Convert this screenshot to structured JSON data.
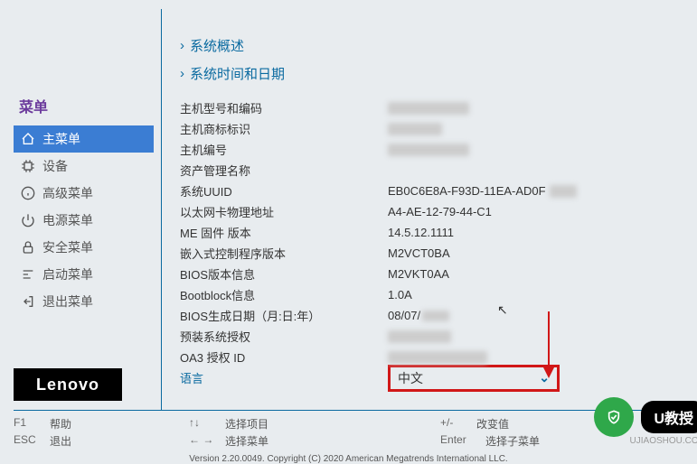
{
  "sidebar": {
    "title": "菜单",
    "items": [
      {
        "label": "主菜单"
      },
      {
        "label": "设备"
      },
      {
        "label": "高级菜单"
      },
      {
        "label": "电源菜单"
      },
      {
        "label": "安全菜单"
      },
      {
        "label": "启动菜单"
      },
      {
        "label": "退出菜单"
      }
    ],
    "logo": "Lenovo"
  },
  "links": {
    "overview": "系统概述",
    "datetime": "系统时间和日期"
  },
  "info": {
    "rows": [
      {
        "label": "主机型号和编码",
        "value": ""
      },
      {
        "label": "主机商标标识",
        "value": ""
      },
      {
        "label": "主机编号",
        "value": ""
      },
      {
        "label": "资产管理名称",
        "value": ""
      },
      {
        "label": "系统UUID",
        "value": "EB0C6E8A-F93D-11EA-AD0F"
      },
      {
        "label": "以太网卡物理地址",
        "value": "A4-AE-12-79-44-C1"
      },
      {
        "label": "ME 固件 版本",
        "value": "14.5.12.1111"
      },
      {
        "label": "嵌入式控制程序版本",
        "value": "M2VCT0BA"
      },
      {
        "label": "BIOS版本信息",
        "value": "M2VKT0AA"
      },
      {
        "label": "Bootblock信息",
        "value": "1.0A"
      },
      {
        "label": "BIOS生成日期（月:日:年）",
        "value": "08/07/"
      },
      {
        "label": "预装系统授权",
        "value": ""
      },
      {
        "label": "OA3 授权 ID",
        "value": ""
      }
    ],
    "language": {
      "label": "语言",
      "value": "中文"
    }
  },
  "footer": {
    "f1": {
      "k": "F1",
      "v": "帮助"
    },
    "esc": {
      "k": "ESC",
      "v": "退出"
    },
    "updown": {
      "k": "↑↓",
      "v": "选择项目"
    },
    "leftright": {
      "k": "← →",
      "v": "选择菜单"
    },
    "plusminus": {
      "k": "+/-",
      "v": "改变值"
    },
    "enter": {
      "k": "Enter",
      "v": "选择子菜单"
    },
    "copyright": "Version 2.20.0049. Copyright (C) 2020 American Megatrends International LLC."
  },
  "watermark": {
    "text": "U教授",
    "domain": "UJIAOSHOU.COM"
  }
}
